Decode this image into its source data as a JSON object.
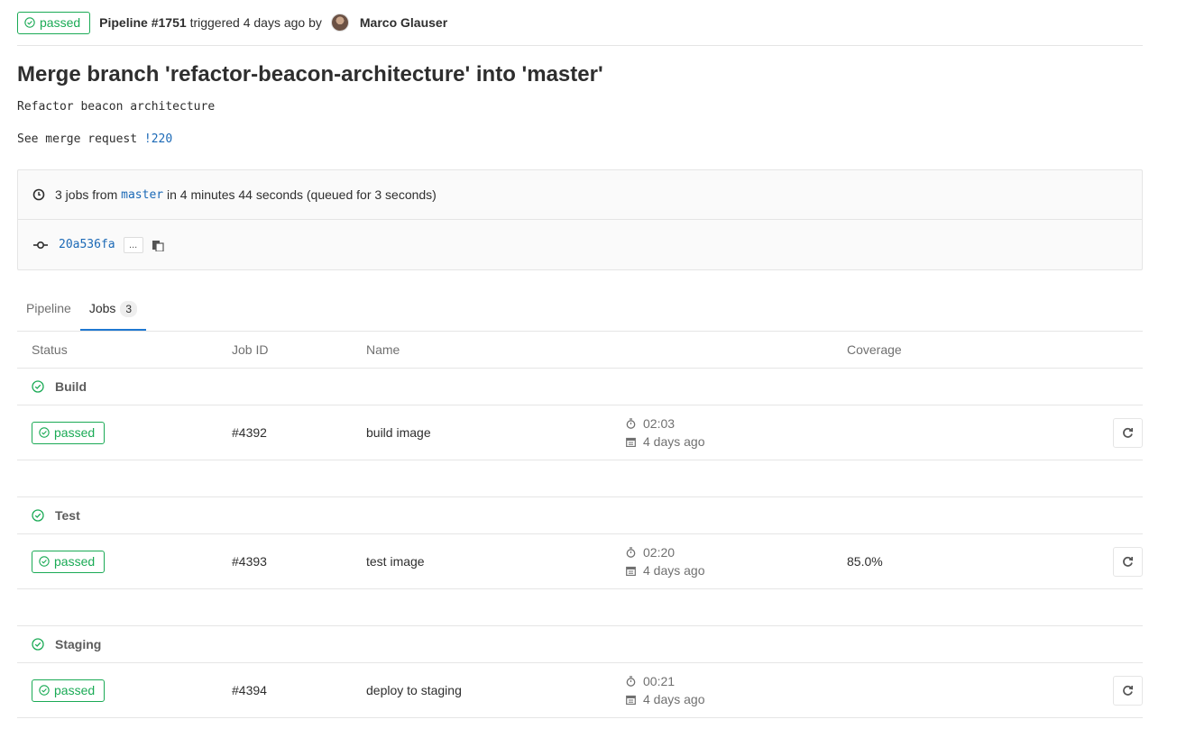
{
  "header": {
    "status": "passed",
    "pipeline": "Pipeline #1751",
    "triggered_text": "triggered 4 days ago by",
    "author": "Marco Glauser"
  },
  "commit": {
    "title": "Merge branch 'refactor-beacon-architecture' into 'master'",
    "description_line": "Refactor beacon architecture",
    "see_mr_text": "See merge request",
    "mr_link": "!220"
  },
  "info": {
    "jobs_count_text": "3 jobs from",
    "branch": "master",
    "duration_text": "in 4 minutes 44 seconds (queued for 3 seconds)",
    "sha": "20a536fa",
    "ellipsis": "..."
  },
  "tabs": [
    {
      "label": "Pipeline"
    },
    {
      "label": "Jobs",
      "count": "3"
    }
  ],
  "table": {
    "headers": {
      "status": "Status",
      "job_id": "Job ID",
      "name": "Name",
      "coverage": "Coverage"
    },
    "stages": [
      {
        "name": "Build",
        "job": {
          "status": "passed",
          "id": "#4392",
          "name": "build image",
          "duration": "02:03",
          "finished": "4 days ago",
          "coverage": ""
        }
      },
      {
        "name": "Test",
        "job": {
          "status": "passed",
          "id": "#4393",
          "name": "test image",
          "duration": "02:20",
          "finished": "4 days ago",
          "coverage": "85.0%"
        }
      },
      {
        "name": "Staging",
        "job": {
          "status": "passed",
          "id": "#4394",
          "name": "deploy to staging",
          "duration": "00:21",
          "finished": "4 days ago",
          "coverage": ""
        }
      }
    ]
  },
  "colors": {
    "success": "#1aaa55",
    "link": "#1b69b6",
    "tab_active": "#1f78d1"
  }
}
